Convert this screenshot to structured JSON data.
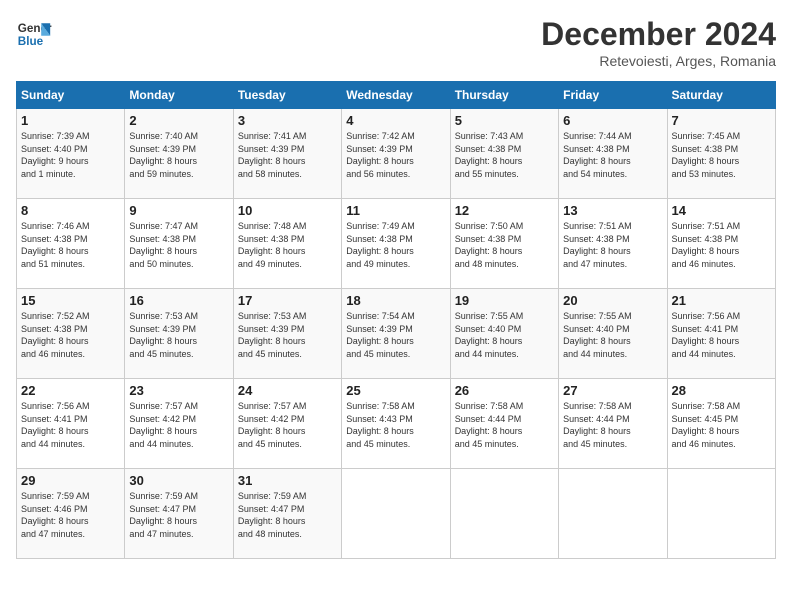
{
  "header": {
    "logo_text_general": "General",
    "logo_text_blue": "Blue",
    "month_year": "December 2024",
    "location": "Retevoiesti, Arges, Romania"
  },
  "calendar": {
    "days_of_week": [
      "Sunday",
      "Monday",
      "Tuesday",
      "Wednesday",
      "Thursday",
      "Friday",
      "Saturday"
    ],
    "weeks": [
      [
        {
          "day": "1",
          "info": "Sunrise: 7:39 AM\nSunset: 4:40 PM\nDaylight: 9 hours\nand 1 minute."
        },
        {
          "day": "2",
          "info": "Sunrise: 7:40 AM\nSunset: 4:39 PM\nDaylight: 8 hours\nand 59 minutes."
        },
        {
          "day": "3",
          "info": "Sunrise: 7:41 AM\nSunset: 4:39 PM\nDaylight: 8 hours\nand 58 minutes."
        },
        {
          "day": "4",
          "info": "Sunrise: 7:42 AM\nSunset: 4:39 PM\nDaylight: 8 hours\nand 56 minutes."
        },
        {
          "day": "5",
          "info": "Sunrise: 7:43 AM\nSunset: 4:38 PM\nDaylight: 8 hours\nand 55 minutes."
        },
        {
          "day": "6",
          "info": "Sunrise: 7:44 AM\nSunset: 4:38 PM\nDaylight: 8 hours\nand 54 minutes."
        },
        {
          "day": "7",
          "info": "Sunrise: 7:45 AM\nSunset: 4:38 PM\nDaylight: 8 hours\nand 53 minutes."
        }
      ],
      [
        {
          "day": "8",
          "info": "Sunrise: 7:46 AM\nSunset: 4:38 PM\nDaylight: 8 hours\nand 51 minutes."
        },
        {
          "day": "9",
          "info": "Sunrise: 7:47 AM\nSunset: 4:38 PM\nDaylight: 8 hours\nand 50 minutes."
        },
        {
          "day": "10",
          "info": "Sunrise: 7:48 AM\nSunset: 4:38 PM\nDaylight: 8 hours\nand 49 minutes."
        },
        {
          "day": "11",
          "info": "Sunrise: 7:49 AM\nSunset: 4:38 PM\nDaylight: 8 hours\nand 49 minutes."
        },
        {
          "day": "12",
          "info": "Sunrise: 7:50 AM\nSunset: 4:38 PM\nDaylight: 8 hours\nand 48 minutes."
        },
        {
          "day": "13",
          "info": "Sunrise: 7:51 AM\nSunset: 4:38 PM\nDaylight: 8 hours\nand 47 minutes."
        },
        {
          "day": "14",
          "info": "Sunrise: 7:51 AM\nSunset: 4:38 PM\nDaylight: 8 hours\nand 46 minutes."
        }
      ],
      [
        {
          "day": "15",
          "info": "Sunrise: 7:52 AM\nSunset: 4:38 PM\nDaylight: 8 hours\nand 46 minutes."
        },
        {
          "day": "16",
          "info": "Sunrise: 7:53 AM\nSunset: 4:39 PM\nDaylight: 8 hours\nand 45 minutes."
        },
        {
          "day": "17",
          "info": "Sunrise: 7:53 AM\nSunset: 4:39 PM\nDaylight: 8 hours\nand 45 minutes."
        },
        {
          "day": "18",
          "info": "Sunrise: 7:54 AM\nSunset: 4:39 PM\nDaylight: 8 hours\nand 45 minutes."
        },
        {
          "day": "19",
          "info": "Sunrise: 7:55 AM\nSunset: 4:40 PM\nDaylight: 8 hours\nand 44 minutes."
        },
        {
          "day": "20",
          "info": "Sunrise: 7:55 AM\nSunset: 4:40 PM\nDaylight: 8 hours\nand 44 minutes."
        },
        {
          "day": "21",
          "info": "Sunrise: 7:56 AM\nSunset: 4:41 PM\nDaylight: 8 hours\nand 44 minutes."
        }
      ],
      [
        {
          "day": "22",
          "info": "Sunrise: 7:56 AM\nSunset: 4:41 PM\nDaylight: 8 hours\nand 44 minutes."
        },
        {
          "day": "23",
          "info": "Sunrise: 7:57 AM\nSunset: 4:42 PM\nDaylight: 8 hours\nand 44 minutes."
        },
        {
          "day": "24",
          "info": "Sunrise: 7:57 AM\nSunset: 4:42 PM\nDaylight: 8 hours\nand 45 minutes."
        },
        {
          "day": "25",
          "info": "Sunrise: 7:58 AM\nSunset: 4:43 PM\nDaylight: 8 hours\nand 45 minutes."
        },
        {
          "day": "26",
          "info": "Sunrise: 7:58 AM\nSunset: 4:44 PM\nDaylight: 8 hours\nand 45 minutes."
        },
        {
          "day": "27",
          "info": "Sunrise: 7:58 AM\nSunset: 4:44 PM\nDaylight: 8 hours\nand 45 minutes."
        },
        {
          "day": "28",
          "info": "Sunrise: 7:58 AM\nSunset: 4:45 PM\nDaylight: 8 hours\nand 46 minutes."
        }
      ],
      [
        {
          "day": "29",
          "info": "Sunrise: 7:59 AM\nSunset: 4:46 PM\nDaylight: 8 hours\nand 47 minutes."
        },
        {
          "day": "30",
          "info": "Sunrise: 7:59 AM\nSunset: 4:47 PM\nDaylight: 8 hours\nand 47 minutes."
        },
        {
          "day": "31",
          "info": "Sunrise: 7:59 AM\nSunset: 4:47 PM\nDaylight: 8 hours\nand 48 minutes."
        },
        {
          "day": "",
          "info": ""
        },
        {
          "day": "",
          "info": ""
        },
        {
          "day": "",
          "info": ""
        },
        {
          "day": "",
          "info": ""
        }
      ]
    ]
  }
}
